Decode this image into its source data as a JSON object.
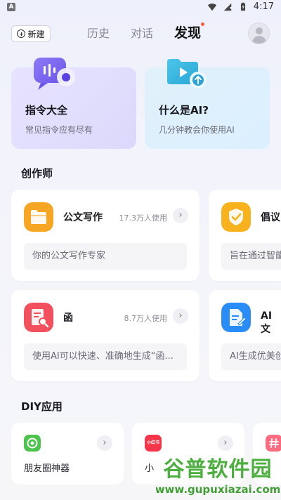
{
  "status_bar": {
    "left_badge": "A",
    "time": "4:17",
    "icons": [
      "wifi-icon",
      "signal-icon",
      "battery-icon"
    ]
  },
  "header": {
    "new_button": "新建",
    "tabs": [
      {
        "label": "历史",
        "active": false
      },
      {
        "label": "对话",
        "active": false
      },
      {
        "label": "发现",
        "active": true
      }
    ]
  },
  "feature_cards": [
    {
      "title": "指令大全",
      "subtitle": "常见指令应有尽有",
      "icon": "voice-chat-icon"
    },
    {
      "title": "什么是AI?",
      "subtitle": "几分钟教会你使用AI",
      "icon": "video-upload-icon"
    }
  ],
  "creators": {
    "title": "创作师",
    "items": [
      {
        "title": "公文写作",
        "usage": "17.3万人使用",
        "desc": "你的公文写作专家",
        "icon": "folder-icon",
        "color": "#f6a623"
      },
      {
        "title": "倡议",
        "usage": "",
        "desc": "旨在通过智能",
        "icon": "shield-check-icon",
        "color": "#f7b21e"
      },
      {
        "title": "函",
        "usage": "8.7万人使用",
        "desc": "使用AI可以快速、准确地生成“函...",
        "icon": "document-search-icon",
        "color": "#f1505c"
      },
      {
        "title": "AI文",
        "usage": "",
        "desc": "AI生成优美创",
        "icon": "document-edit-icon",
        "color": "#2a8cf6"
      }
    ]
  },
  "diy": {
    "title": "DIY应用",
    "items": [
      {
        "title": "朋友圈神器",
        "icon": "camera-aperture-icon",
        "color": "#4cc34a"
      },
      {
        "title": "小",
        "icon": "xiaohongshu-icon",
        "icon_text": "小红书",
        "color": "#f5364a"
      },
      {
        "title": "",
        "icon": "hashtag-icon",
        "color": "#ff6b81"
      }
    ]
  },
  "watermark": {
    "line1": "谷普软件园",
    "line2": "www.gupuxiazai.com"
  }
}
